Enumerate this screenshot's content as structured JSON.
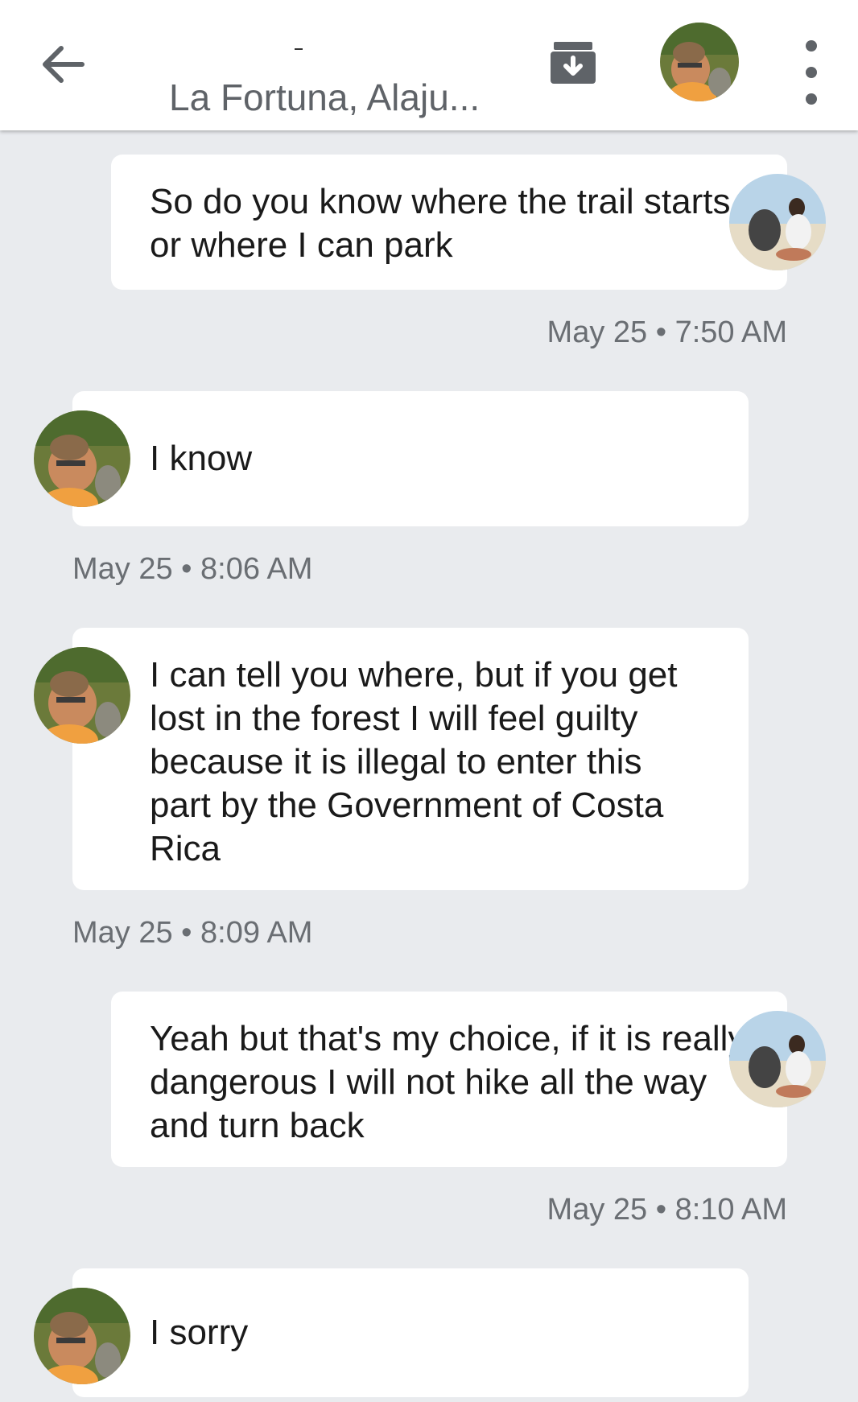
{
  "header": {
    "title": "-",
    "subtitle": "La Fortuna, Alaju..."
  },
  "icons": {
    "back": "back-arrow-icon",
    "archive": "archive-icon",
    "menu": "more-vert-icon"
  },
  "colors": {
    "background": "#e9ebee",
    "bubble": "#ffffff",
    "icon": "#5f6368"
  },
  "messages": [
    {
      "sender": "self",
      "text": "So do you know where the trail starts or where I can park",
      "timestamp": "May 25 • 7:50 AM"
    },
    {
      "sender": "other",
      "text": "I know",
      "timestamp": "May 25 • 8:06 AM"
    },
    {
      "sender": "other",
      "text": "I can tell you where, but if you get lost in the forest I will feel guilty because it is illegal to enter this part by the Government of Costa Rica",
      "timestamp": "May 25 • 8:09 AM"
    },
    {
      "sender": "self",
      "text": "Yeah but that's my choice, if it is really dangerous I will not hike all the way and turn back",
      "timestamp": "May 25 • 8:10 AM"
    },
    {
      "sender": "other",
      "text": "I sorry",
      "timestamp": ""
    }
  ]
}
